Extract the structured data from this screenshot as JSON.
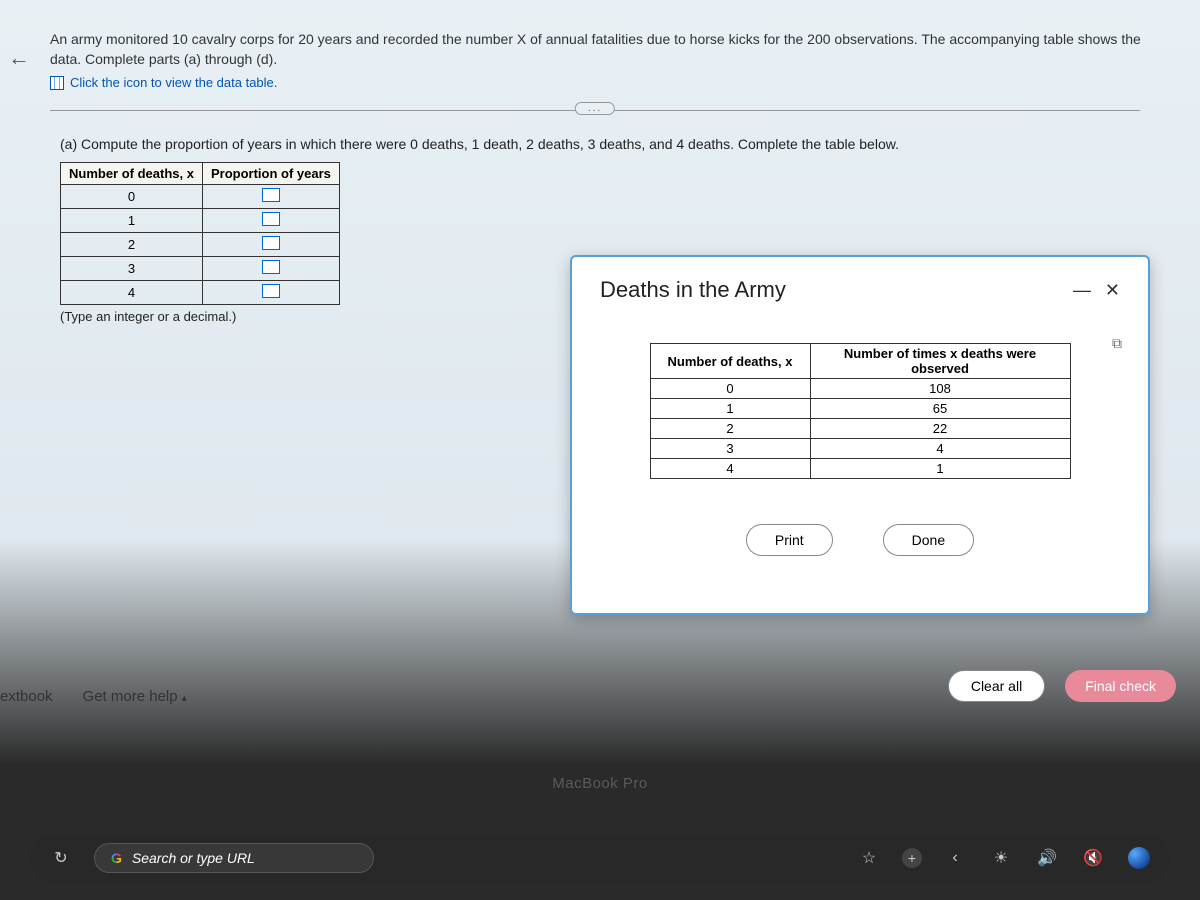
{
  "problem": {
    "text": "An army monitored 10 cavalry corps for 20 years and recorded the number X of annual fatalities due to horse kicks for the 200 observations. The accompanying table shows the data. Complete parts (a) through (d).",
    "data_link": "Click the icon to view the data table.",
    "ellipsis": "..."
  },
  "part_a": {
    "prompt": "(a) Compute the proportion of years in which there were 0 deaths, 1 death, 2 deaths, 3 deaths, and 4 deaths. Complete the table below.",
    "col1": "Number of deaths, x",
    "col2": "Proportion of years",
    "rows": [
      "0",
      "1",
      "2",
      "3",
      "4"
    ],
    "hint": "(Type an integer or a decimal.)"
  },
  "popup": {
    "title": "Deaths in the Army",
    "minimize": "—",
    "close": "✕",
    "copy": "⧉",
    "col1": "Number of deaths, x",
    "col2": "Number of times x deaths were observed",
    "data": [
      {
        "x": "0",
        "n": "108"
      },
      {
        "x": "1",
        "n": "65"
      },
      {
        "x": "2",
        "n": "22"
      },
      {
        "x": "3",
        "n": "4"
      },
      {
        "x": "4",
        "n": "1"
      }
    ],
    "print": "Print",
    "done": "Done"
  },
  "actions": {
    "clear": "Clear all",
    "final": "Final check"
  },
  "footer": {
    "textbook": "extbook",
    "help": "Get more help",
    "caret": "▴"
  },
  "device": "MacBook Pro",
  "taskbar": {
    "reload": "↻",
    "g": "G",
    "search_placeholder": "Search or type URL",
    "star": "☆",
    "plus": "+",
    "back": "‹",
    "bright": "☀",
    "vol": "🔊",
    "mute": "🔇",
    "add": "+"
  }
}
